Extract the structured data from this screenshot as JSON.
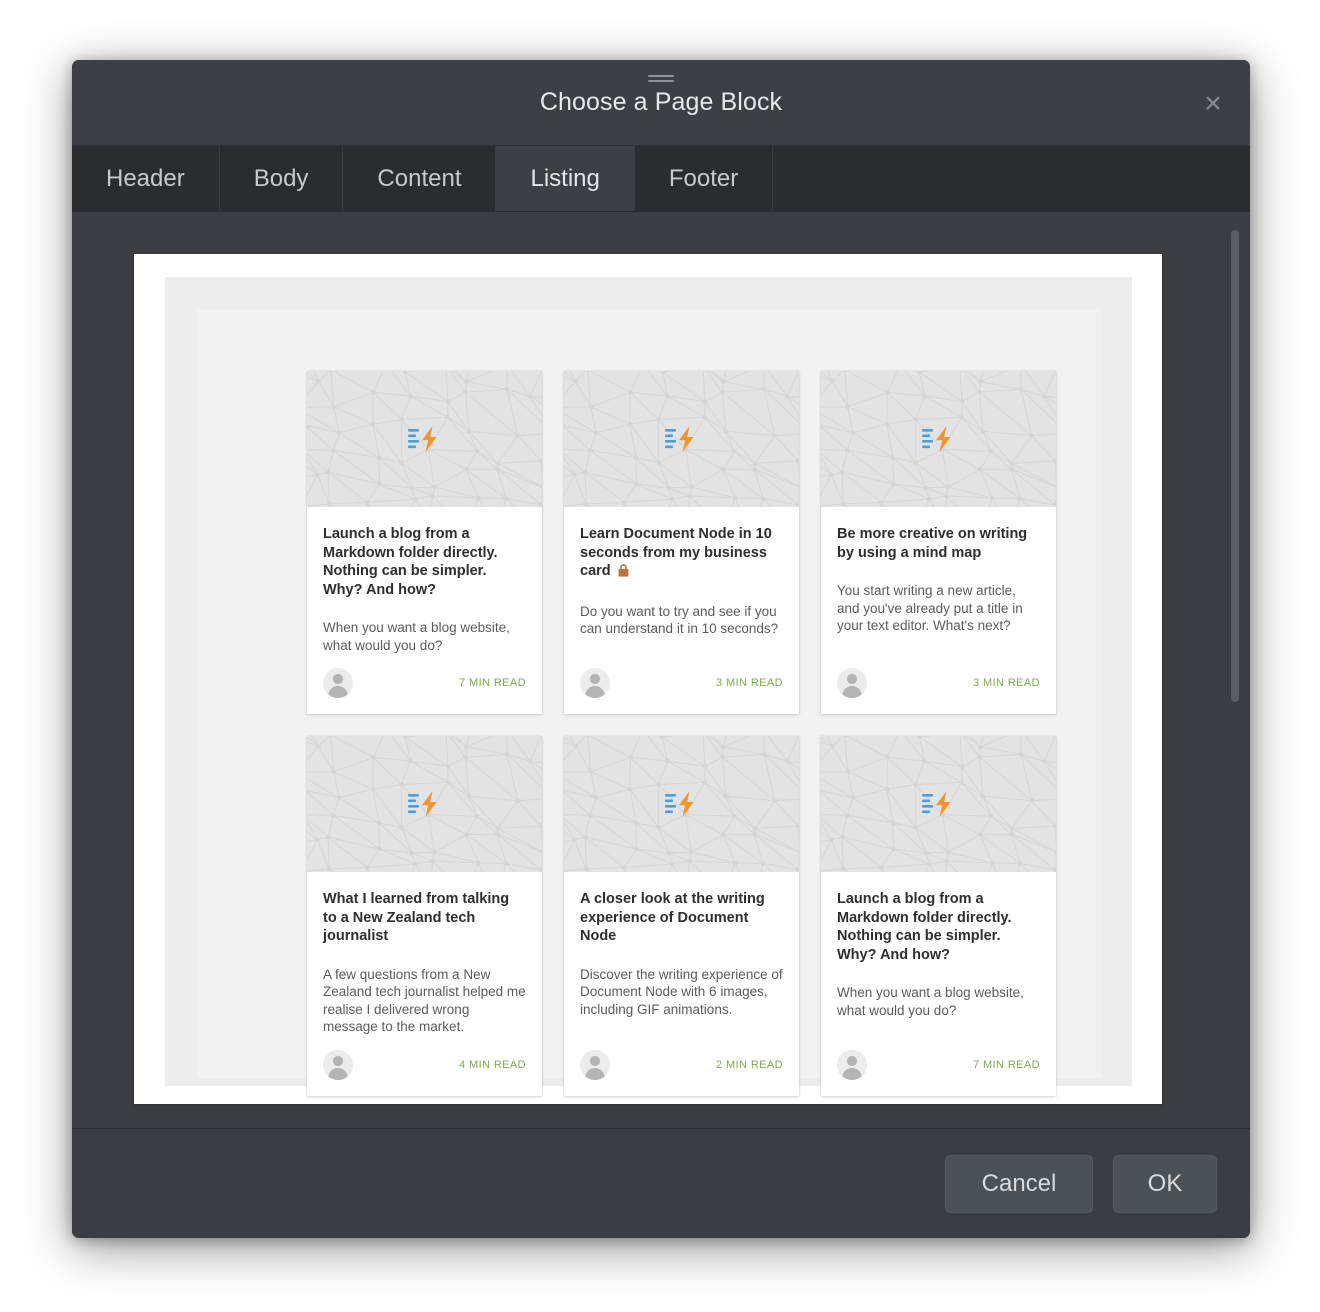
{
  "window": {
    "title": "Choose a Page Block",
    "close_label": "×",
    "grip_name": "drag-handle"
  },
  "tabs": [
    {
      "label": "Header",
      "active": false
    },
    {
      "label": "Body",
      "active": false
    },
    {
      "label": "Content",
      "active": false
    },
    {
      "label": "Listing",
      "active": true
    },
    {
      "label": "Footer",
      "active": false
    }
  ],
  "colors": {
    "dialog_bg": "#3a3e42",
    "titlebar_bg": "#3c4044",
    "tabstrip_bg": "#2a2d2f",
    "active_tab_bg": "#3c4044",
    "read_time_green": "#7bac4e",
    "lock_orange": "#c0713a",
    "bolt_orange": "#f0952f",
    "bolt_lines_blue": "#4a9fe0",
    "button_bg": "#4c5155"
  },
  "preview": {
    "cards": [
      {
        "title": "Launch a blog from a Markdown folder directly. Nothing can be simpler. Why? And how?",
        "excerpt": "When you want a blog website, what would you do?",
        "read_time": "7 MIN READ",
        "locked": false,
        "thumb_icon": "document-lightning-icon",
        "avatar_icon": "user-avatar-icon"
      },
      {
        "title": "Learn Document Node in 10 seconds from my business card",
        "excerpt": "Do you want to try and see if you can understand it in 10 seconds?",
        "read_time": "3 MIN READ",
        "locked": true,
        "thumb_icon": "document-lightning-icon",
        "avatar_icon": "user-avatar-icon"
      },
      {
        "title": "Be more creative on writing by using a mind map",
        "excerpt": "You start writing a new article, and you've already put a title in your text editor. What's next?",
        "read_time": "3 MIN READ",
        "locked": false,
        "thumb_icon": "document-lightning-icon",
        "avatar_icon": "user-avatar-icon"
      },
      {
        "title": "What I learned from talking to a New Zealand tech journalist",
        "excerpt": "A few questions from a New Zealand tech journalist helped me realise I delivered wrong message to the market.",
        "read_time": "4 MIN READ",
        "locked": false,
        "thumb_icon": "document-lightning-icon",
        "avatar_icon": "user-avatar-icon"
      },
      {
        "title": "A closer look at the writing experience of Document Node",
        "excerpt": "Discover the writing experience of Document Node with 6 images, including GIF animations.",
        "read_time": "2 MIN READ",
        "locked": false,
        "thumb_icon": "document-lightning-icon",
        "avatar_icon": "user-avatar-icon"
      },
      {
        "title": "Launch a blog from a Markdown folder directly. Nothing can be simpler. Why? And how?",
        "excerpt": "When you want a blog website, what would you do?",
        "read_time": "7 MIN READ",
        "locked": false,
        "thumb_icon": "document-lightning-icon",
        "avatar_icon": "user-avatar-icon"
      }
    ]
  },
  "footer": {
    "cancel_label": "Cancel",
    "ok_label": "OK"
  }
}
